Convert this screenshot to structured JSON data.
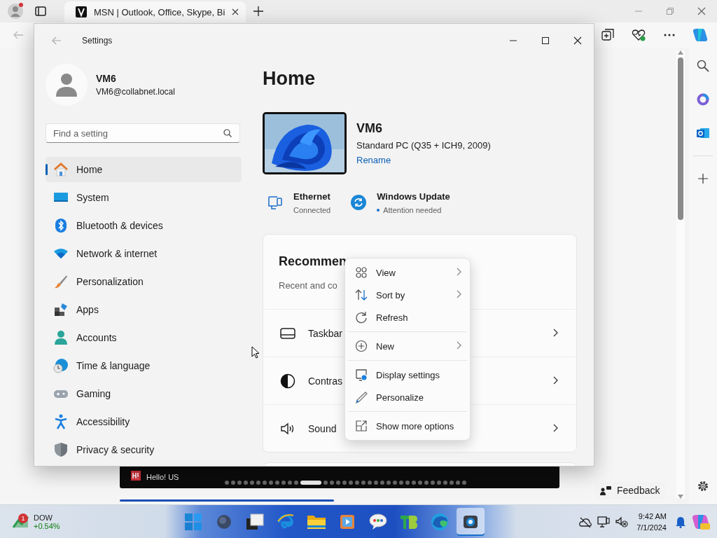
{
  "browser": {
    "tab": {
      "title": "MSN | Outlook, Office, Skype, Bi"
    }
  },
  "settings_window": {
    "title": "Settings",
    "account": {
      "name": "VM6",
      "email": "VM6@collabnet.local"
    },
    "search": {
      "placeholder": "Find a setting"
    },
    "nav": [
      {
        "label": "Home",
        "selected": true
      },
      {
        "label": "System",
        "selected": false
      },
      {
        "label": "Bluetooth & devices",
        "selected": false
      },
      {
        "label": "Network & internet",
        "selected": false
      },
      {
        "label": "Personalization",
        "selected": false
      },
      {
        "label": "Apps",
        "selected": false
      },
      {
        "label": "Accounts",
        "selected": false
      },
      {
        "label": "Time & language",
        "selected": false
      },
      {
        "label": "Gaming",
        "selected": false
      },
      {
        "label": "Accessibility",
        "selected": false
      },
      {
        "label": "Privacy & security",
        "selected": false
      }
    ],
    "page_title": "Home",
    "device": {
      "name": "VM6",
      "model": "Standard PC (Q35 + ICH9, 2009)",
      "rename": "Rename"
    },
    "status": [
      {
        "title": "Ethernet",
        "detail": "Connected",
        "attention": false
      },
      {
        "title": "Windows Update",
        "detail": "Attention needed",
        "attention": true
      }
    ],
    "recommended": {
      "title": "Recommen",
      "subtitle": "Recent and co",
      "items": [
        "Taskbar",
        "Contras",
        "Sound"
      ]
    }
  },
  "context_menu": {
    "groups": [
      [
        {
          "label": "View",
          "submenu": true
        },
        {
          "label": "Sort by",
          "submenu": true
        },
        {
          "label": "Refresh",
          "submenu": false
        }
      ],
      [
        {
          "label": "New",
          "submenu": true
        }
      ],
      [
        {
          "label": "Display settings",
          "submenu": false
        },
        {
          "label": "Personalize",
          "submenu": false
        }
      ],
      [
        {
          "label": "Show more options",
          "submenu": false
        }
      ]
    ]
  },
  "page_behind": {
    "carousel": {
      "label": "Hello! US",
      "pages": [
        {
          "selected": false
        },
        {
          "selected": false
        },
        {
          "selected": false
        },
        {
          "selected": false
        },
        {
          "selected": false
        },
        {
          "selected": false
        },
        {
          "selected": false
        },
        {
          "selected": false
        },
        {
          "selected": false
        },
        {
          "selected": false
        },
        {
          "selected": false
        },
        {
          "selected": false
        },
        {
          "selected": true
        },
        {
          "selected": false
        },
        {
          "selected": false
        },
        {
          "selected": false
        },
        {
          "selected": false
        },
        {
          "selected": false
        },
        {
          "selected": false
        },
        {
          "selected": false
        },
        {
          "selected": false
        },
        {
          "selected": false
        },
        {
          "selected": false
        },
        {
          "selected": false
        },
        {
          "selected": false
        },
        {
          "selected": false
        },
        {
          "selected": false
        },
        {
          "selected": false
        },
        {
          "selected": false
        },
        {
          "selected": false
        },
        {
          "selected": false
        },
        {
          "selected": false
        },
        {
          "selected": false
        },
        {
          "selected": false
        },
        {
          "selected": false
        },
        {
          "selected": false
        }
      ]
    },
    "feedback": "Feedback"
  },
  "taskbar": {
    "widget": {
      "badge": "1",
      "name": "DOW",
      "change": "+0.54%"
    },
    "apps": [
      {
        "selected": false
      },
      {
        "selected": false
      },
      {
        "selected": false
      },
      {
        "selected": false
      },
      {
        "selected": false
      },
      {
        "selected": false
      },
      {
        "selected": false
      },
      {
        "selected": false
      },
      {
        "selected": false
      },
      {
        "selected": true
      }
    ],
    "clock": {
      "time": "9:42 AM",
      "date": "7/1/2024"
    }
  }
}
